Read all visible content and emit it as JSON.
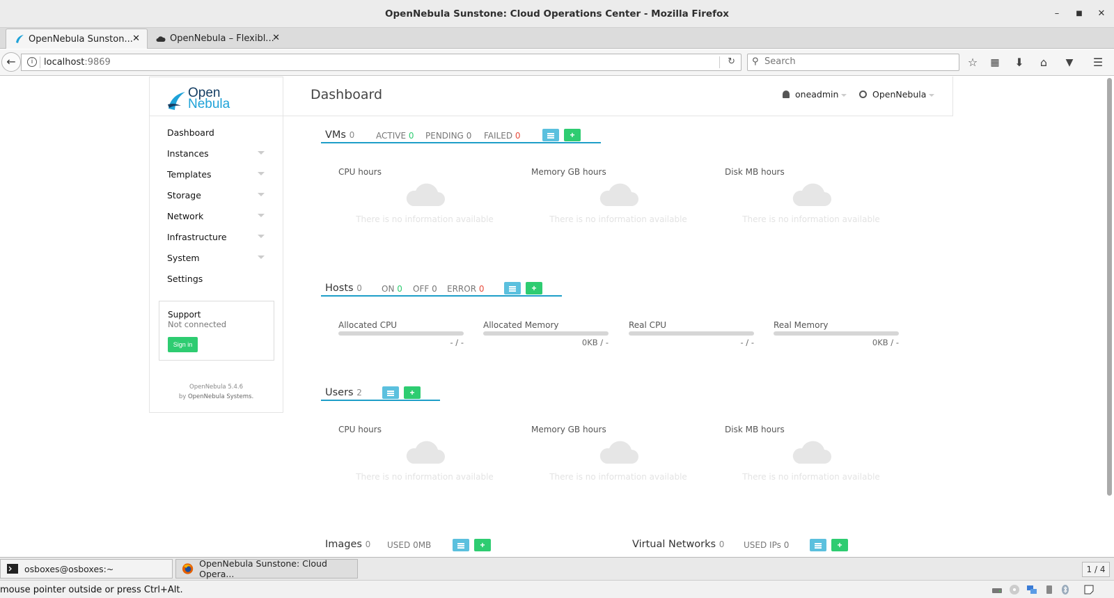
{
  "window": {
    "title": "OpenNebula Sunstone: Cloud Operations Center - Mozilla Firefox"
  },
  "tabs": [
    {
      "label": "OpenNebula Sunston...",
      "active": true
    },
    {
      "label": "OpenNebula – Flexibl...",
      "active": false
    }
  ],
  "navbar": {
    "url_host": "localhost",
    "url_port": ":9869",
    "search_placeholder": "Search"
  },
  "sidebar": {
    "logo_line1": "Open",
    "logo_line2": "Nebula",
    "items": [
      {
        "label": "Dashboard",
        "has_submenu": false
      },
      {
        "label": "Instances",
        "has_submenu": true
      },
      {
        "label": "Templates",
        "has_submenu": true
      },
      {
        "label": "Storage",
        "has_submenu": true
      },
      {
        "label": "Network",
        "has_submenu": true
      },
      {
        "label": "Infrastructure",
        "has_submenu": true
      },
      {
        "label": "System",
        "has_submenu": true
      },
      {
        "label": "Settings",
        "has_submenu": false
      }
    ],
    "support": {
      "title": "Support",
      "status": "Not connected",
      "signin_label": "Sign in"
    },
    "version": "OpenNebula 5.4.6",
    "by_prefix": "by",
    "by": "OpenNebula Systems."
  },
  "header": {
    "title": "Dashboard",
    "user": "oneadmin",
    "zone": "OpenNebula"
  },
  "vms": {
    "title": "VMs",
    "count": "0",
    "active_label": "ACTIVE",
    "active": "0",
    "pending_label": "PENDING",
    "pending": "0",
    "failed_label": "FAILED",
    "failed": "0",
    "metrics": [
      "CPU hours",
      "Memory GB hours",
      "Disk MB hours"
    ],
    "empty_text": "There is no information available"
  },
  "hosts": {
    "title": "Hosts",
    "count": "0",
    "on_label": "ON",
    "on": "0",
    "off_label": "OFF",
    "off": "0",
    "error_label": "ERROR",
    "error": "0",
    "bars": [
      {
        "label": "Allocated CPU",
        "value": "- / -"
      },
      {
        "label": "Allocated Memory",
        "value": "0KB / -"
      },
      {
        "label": "Real CPU",
        "value": "- / -"
      },
      {
        "label": "Real Memory",
        "value": "0KB / -"
      }
    ]
  },
  "users": {
    "title": "Users",
    "count": "2",
    "metrics": [
      "CPU hours",
      "Memory GB hours",
      "Disk MB hours"
    ],
    "empty_text": "There is no information available"
  },
  "images": {
    "title": "Images",
    "count": "0",
    "used_label": "USED",
    "used": "0MB"
  },
  "vnets": {
    "title": "Virtual Networks",
    "count": "0",
    "used_label": "USED IPs",
    "used": "0"
  },
  "taskbar": {
    "tasks": [
      {
        "label": "osboxes@osboxes:~",
        "active": false
      },
      {
        "label": "OpenNebula Sunstone: Cloud Opera...",
        "active": true
      }
    ],
    "pager": "1 / 4"
  },
  "statusbar": {
    "message": "mouse pointer outside or press Ctrl+Alt."
  },
  "colors": {
    "accent": "#1e9ec8",
    "success": "#2ecc71",
    "danger": "#e74c3c",
    "info": "#5bc0de"
  }
}
